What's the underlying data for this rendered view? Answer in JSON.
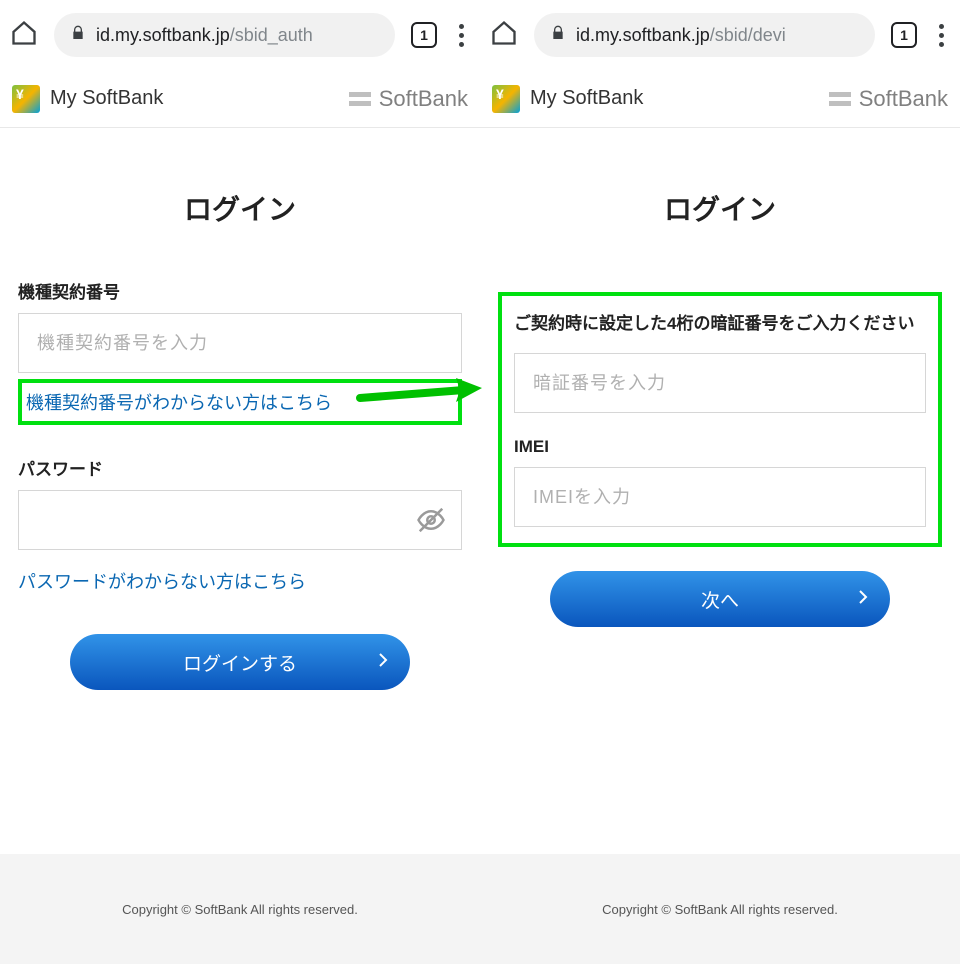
{
  "left": {
    "browser": {
      "url_host": "id.my.softbank.jp",
      "url_path": "/sbid_auth",
      "tab_count": "1"
    },
    "header": {
      "logo_text": "My SoftBank",
      "brand_text": "SoftBank"
    },
    "title": "ログイン",
    "contract_label": "機種契約番号",
    "contract_placeholder": "機種契約番号を入力",
    "contract_help_link": "機種契約番号がわからない方はこちら",
    "password_label": "パスワード",
    "password_help_link": "パスワードがわからない方はこちら",
    "submit_label": "ログインする",
    "footer": "Copyright © SoftBank All rights reserved."
  },
  "right": {
    "browser": {
      "url_host": "id.my.softbank.jp",
      "url_path": "/sbid/devi",
      "tab_count": "1"
    },
    "header": {
      "logo_text": "My SoftBank",
      "brand_text": "SoftBank"
    },
    "title": "ログイン",
    "pin_label": "ご契約時に設定した4桁の暗証番号をご入力ください",
    "pin_placeholder": "暗証番号を入力",
    "imei_label": "IMEI",
    "imei_placeholder": "IMEIを入力",
    "submit_label": "次へ",
    "footer": "Copyright © SoftBank All rights reserved."
  }
}
